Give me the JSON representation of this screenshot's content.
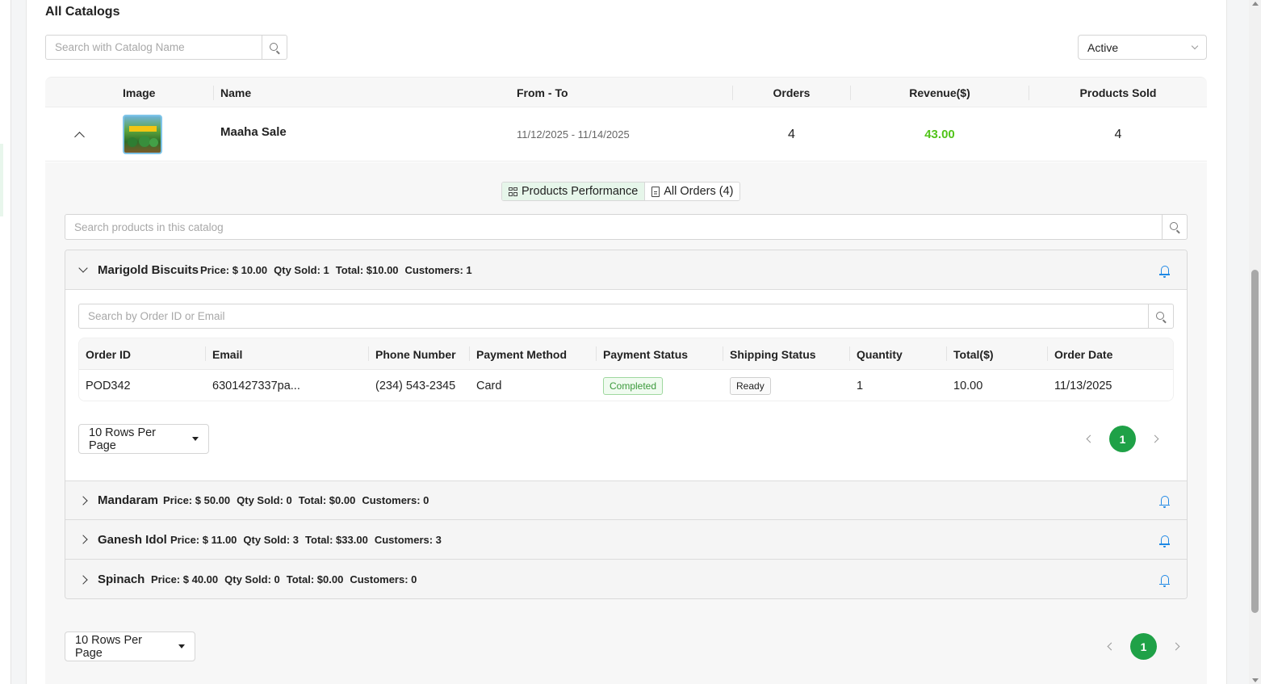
{
  "page": {
    "title": "All Catalogs"
  },
  "catalog_search": {
    "placeholder": "Search with Catalog Name"
  },
  "status_filter": {
    "selected": "Active"
  },
  "catalog_table": {
    "headers": {
      "image": "Image",
      "name": "Name",
      "from_to": "From - To",
      "orders": "Orders",
      "revenue": "Revenue($)",
      "products_sold": "Products Sold"
    },
    "rows": [
      {
        "name": "Maaha Sale",
        "from_to": "11/12/2025 - 11/14/2025",
        "orders": "4",
        "revenue": "43.00",
        "products_sold": "4"
      }
    ]
  },
  "tabs": {
    "products_performance": "Products Performance",
    "all_orders": "All Orders (4)"
  },
  "product_search": {
    "placeholder": "Search products in this catalog"
  },
  "products": [
    {
      "name": "Marigold Biscuits",
      "price": "Price: $ 10.00",
      "qty": "Qty Sold: 1",
      "total": "Total: $10.00",
      "customers": "Customers: 1"
    },
    {
      "name": "Mandaram",
      "price": "Price: $ 50.00",
      "qty": "Qty Sold: 0",
      "total": "Total: $0.00",
      "customers": "Customers: 0"
    },
    {
      "name": "Ganesh Idol",
      "price": "Price: $ 11.00",
      "qty": "Qty Sold: 3",
      "total": "Total: $33.00",
      "customers": "Customers: 3"
    },
    {
      "name": "Spinach",
      "price": "Price: $ 40.00",
      "qty": "Qty Sold: 0",
      "total": "Total: $0.00",
      "customers": "Customers: 0"
    }
  ],
  "order_search": {
    "placeholder": "Search by Order ID or Email"
  },
  "orders_table": {
    "headers": {
      "order_id": "Order ID",
      "email": "Email",
      "phone": "Phone Number",
      "payment_method": "Payment Method",
      "payment_status": "Payment Status",
      "shipping_status": "Shipping Status",
      "quantity": "Quantity",
      "total": "Total($)",
      "order_date": "Order Date"
    },
    "rows": [
      {
        "order_id": "POD342",
        "email": "6301427337pa...",
        "phone": "(234) 543-2345",
        "payment_method": "Card",
        "payment_status": "Completed",
        "shipping_status": "Ready",
        "quantity": "1",
        "total": "10.00",
        "order_date": "11/13/2025"
      }
    ]
  },
  "inner_pagination": {
    "rows_per_page": "10 Rows Per Page",
    "current_page": "1"
  },
  "outer_pagination": {
    "rows_per_page": "10 Rows Per Page",
    "current_page": "1"
  },
  "colors": {
    "accent_green": "#1fa147",
    "revenue_green": "#52c41a",
    "bell_blue": "#1e88e5"
  }
}
